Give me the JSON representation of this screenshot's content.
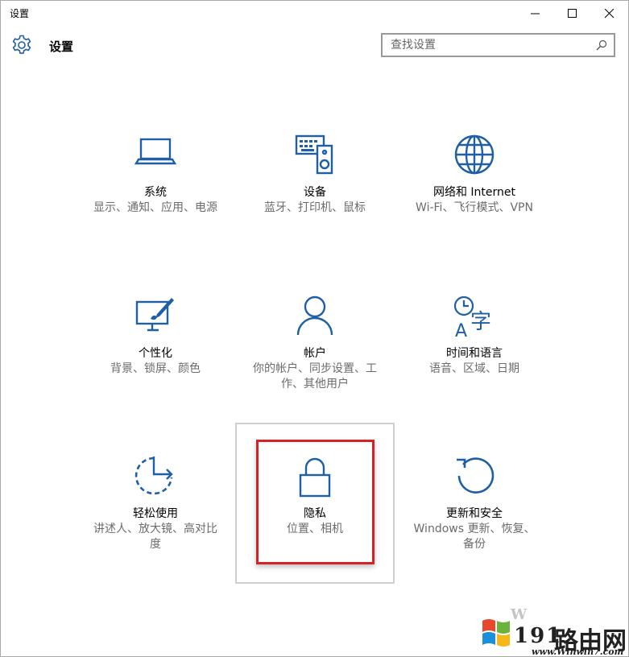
{
  "window": {
    "title": "设置"
  },
  "header": {
    "title": "设置",
    "search_placeholder": "查找设置"
  },
  "tiles": [
    {
      "name": "系统",
      "desc": "显示、通知、应用、电源",
      "icon": "laptop-icon"
    },
    {
      "name": "设备",
      "desc": "蓝牙、打印机、鼠标",
      "icon": "devices-icon"
    },
    {
      "name": "网络和 Internet",
      "desc": "Wi-Fi、飞行模式、VPN",
      "icon": "globe-icon"
    },
    {
      "name": "个性化",
      "desc": "背景、锁屏、颜色",
      "icon": "personalize-icon"
    },
    {
      "name": "帐户",
      "desc": "你的帐户、同步设置、工作、其他用户",
      "icon": "person-icon"
    },
    {
      "name": "时间和语言",
      "desc": "语音、区域、日期",
      "icon": "time-language-icon"
    },
    {
      "name": "轻松使用",
      "desc": "讲述人、放大镜、高对比度",
      "icon": "ease-of-access-icon"
    },
    {
      "name": "隐私",
      "desc": "位置、相机",
      "icon": "lock-icon"
    },
    {
      "name": "更新和安全",
      "desc": "Windows 更新、恢复、备份",
      "icon": "refresh-icon"
    }
  ],
  "watermark": {
    "w": "W",
    "num": "191",
    "cn": "路由网",
    "url": "www.Winwin7.com"
  },
  "colors": {
    "accent": "#1f5fa6",
    "highlight": "#d42326"
  }
}
